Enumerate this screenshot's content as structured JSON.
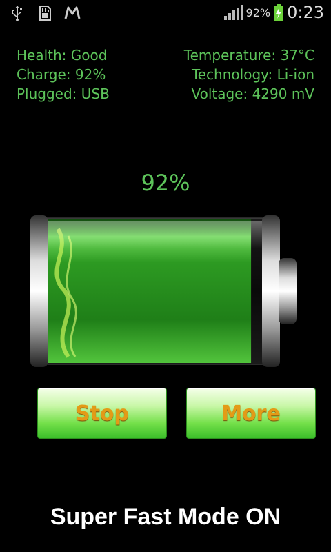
{
  "status_bar": {
    "left_icons": [
      "usb-icon",
      "sd-card-icon",
      "gmail-icon"
    ],
    "battery_percent": "92%",
    "time": "0:23"
  },
  "info": {
    "health": "Health: Good",
    "charge": "Charge: 92%",
    "plugged": "Plugged: USB",
    "temperature": "Temperature: 37°C",
    "technology": "Technology: Li-ion",
    "voltage": "Voltage: 4290 mV"
  },
  "battery": {
    "percent_label": "92%",
    "level": 0.92,
    "fill_color": "#3dbb2a"
  },
  "buttons": {
    "stop": "Stop",
    "more": "More"
  },
  "mode_text": "Super Fast Mode ON",
  "colors": {
    "accent_green": "#5dc35a",
    "button_text": "#e39b17"
  }
}
